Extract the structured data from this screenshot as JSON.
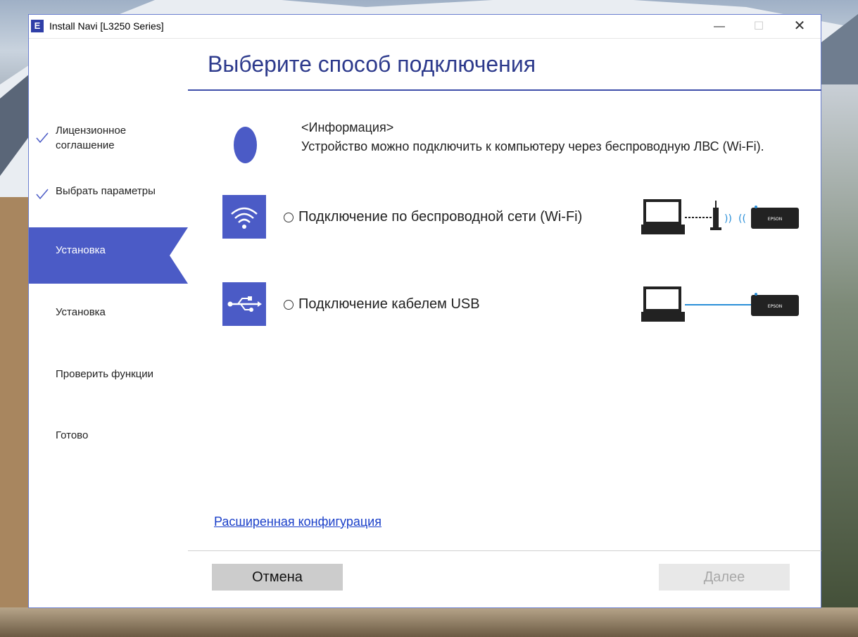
{
  "window": {
    "title": "Install Navi [L3250 Series]",
    "app_icon_letter": "E"
  },
  "sidebar": {
    "steps": [
      {
        "label": "Лицензионное\nсоглашение",
        "completed": true
      },
      {
        "label": "Выбрать параметры",
        "completed": true
      },
      {
        "label": "Установка",
        "active": true
      },
      {
        "label": "Установка"
      },
      {
        "label": "Проверить функции"
      },
      {
        "label": "Готово"
      }
    ]
  },
  "main": {
    "title": "Выберите способ подключения",
    "info_heading": "<Информация>",
    "info_text": "Устройство можно подключить к компьютеру через беспроводную ЛВС (Wi-Fi).",
    "options": [
      {
        "label": "Подключение по беспроводной сети (Wi-Fi)",
        "icon": "wifi-icon",
        "printer_brand": "EPSON"
      },
      {
        "label": "Подключение кабелем USB",
        "icon": "usb-icon",
        "printer_brand": "EPSON"
      }
    ],
    "advanced_link": "Расширенная конфигурация"
  },
  "footer": {
    "cancel_label": "Отмена",
    "next_label": "Далее"
  },
  "colors": {
    "accent": "#4b5bc6",
    "title": "#2d3a8c",
    "link": "#1a3fc9"
  }
}
